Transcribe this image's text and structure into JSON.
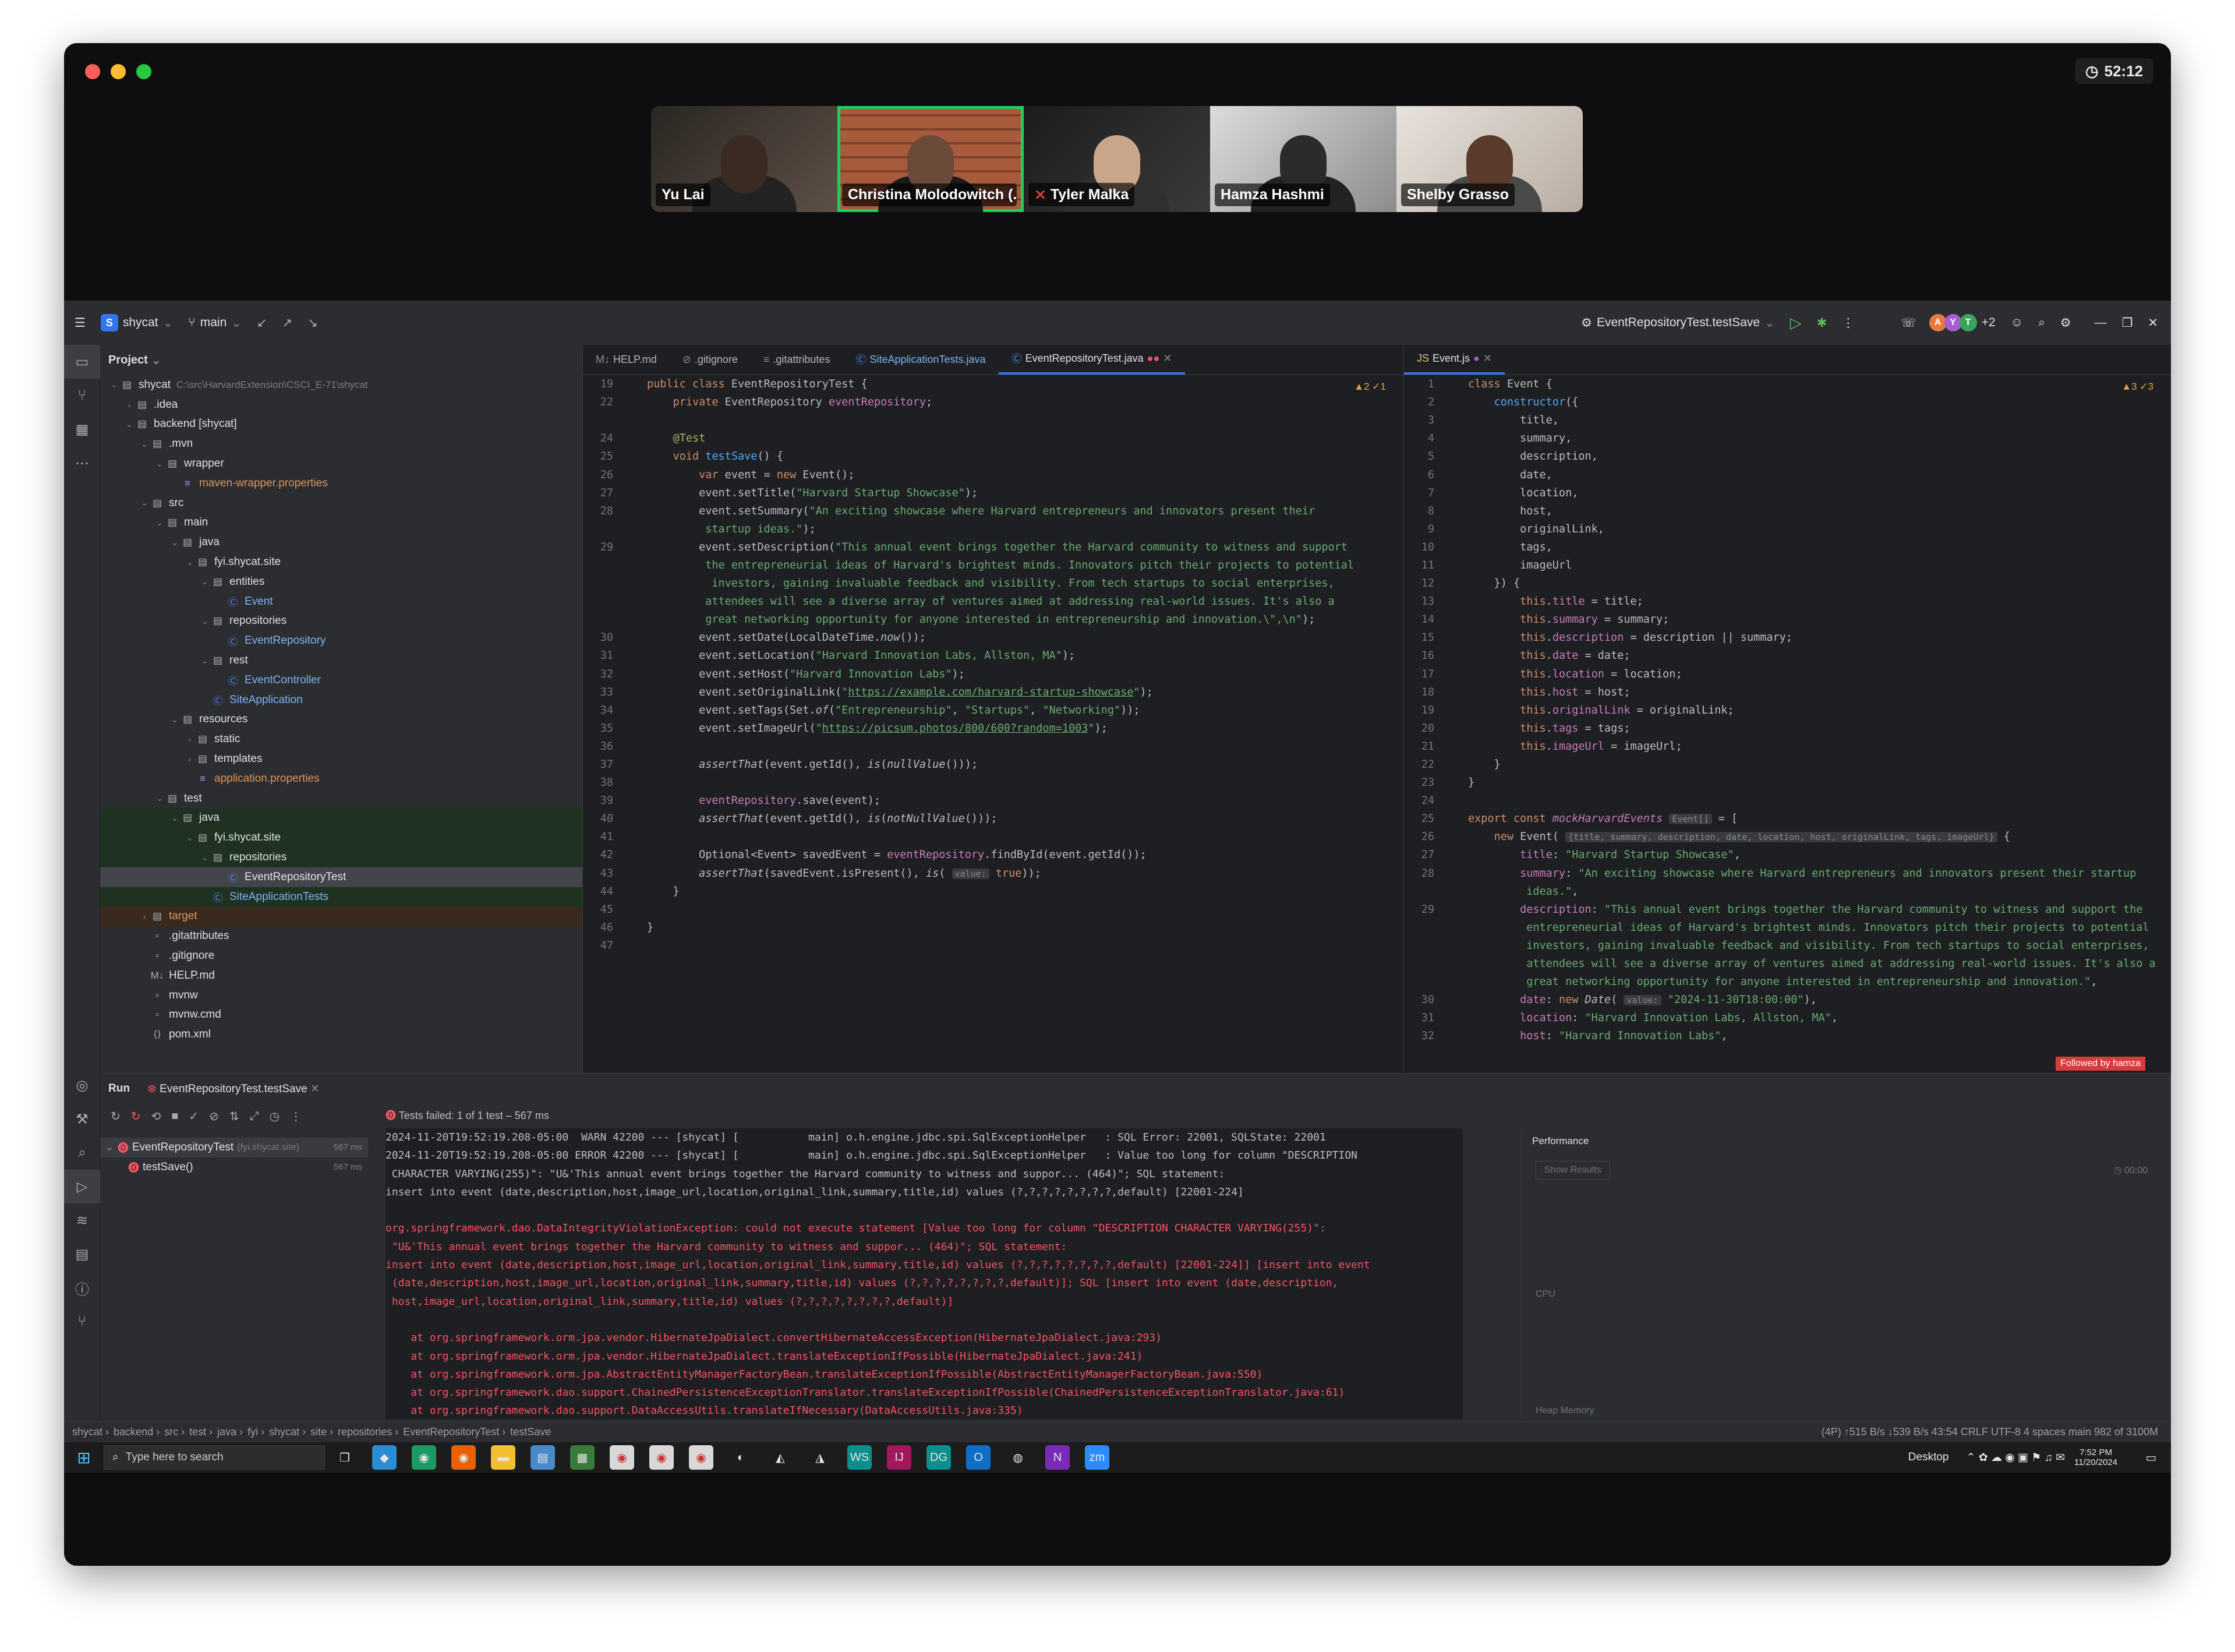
{
  "meeting": {
    "timer": "52:12",
    "participants": [
      "Yu Lai",
      "Christina Molodowitch (...",
      "Tyler Malka",
      "Hamza Hashmi",
      "Shelby Grasso"
    ]
  },
  "ide": {
    "project": "shycat",
    "branch": "main",
    "run_config": "EventRepositoryTest.testSave",
    "extra_users": "+2",
    "avatars": [
      "A",
      "Y",
      "T"
    ],
    "project_label": "Project",
    "tree": [
      {
        "label": "shycat",
        "hint": "C:\\src\\HarvardExtension\\CSCI_E-71\\shycat",
        "indent": 0,
        "icon": "folder",
        "open": true
      },
      {
        "label": ".idea",
        "indent": 1,
        "icon": "folder",
        "open": false
      },
      {
        "label": "backend [shycat]",
        "indent": 1,
        "icon": "folder",
        "open": true
      },
      {
        "label": ".mvn",
        "indent": 2,
        "icon": "folder",
        "open": true
      },
      {
        "label": "wrapper",
        "indent": 3,
        "icon": "folder",
        "open": true
      },
      {
        "label": "maven-wrapper.properties",
        "indent": 4,
        "icon": "props",
        "cls": "tgtf"
      },
      {
        "label": "src",
        "indent": 2,
        "icon": "folder",
        "open": true
      },
      {
        "label": "main",
        "indent": 3,
        "icon": "folder",
        "open": true
      },
      {
        "label": "java",
        "indent": 4,
        "icon": "folder",
        "open": true
      },
      {
        "label": "fyi.shycat.site",
        "indent": 5,
        "icon": "folder",
        "open": true
      },
      {
        "label": "entities",
        "indent": 6,
        "icon": "folder",
        "open": true
      },
      {
        "label": "Event",
        "indent": 7,
        "icon": "class"
      },
      {
        "label": "repositories",
        "indent": 6,
        "icon": "folder",
        "open": true
      },
      {
        "label": "EventRepository",
        "indent": 7,
        "icon": "class"
      },
      {
        "label": "rest",
        "indent": 6,
        "icon": "folder",
        "open": true
      },
      {
        "label": "EventController",
        "indent": 7,
        "icon": "class"
      },
      {
        "label": "SiteApplication",
        "indent": 6,
        "icon": "class"
      },
      {
        "label": "resources",
        "indent": 4,
        "icon": "folder",
        "open": true
      },
      {
        "label": "static",
        "indent": 5,
        "icon": "folder"
      },
      {
        "label": "templates",
        "indent": 5,
        "icon": "folder"
      },
      {
        "label": "application.properties",
        "indent": 5,
        "icon": "props",
        "cls": "tgtf"
      },
      {
        "label": "test",
        "indent": 3,
        "icon": "folder",
        "open": true
      },
      {
        "label": "java",
        "indent": 4,
        "icon": "folder",
        "open": true,
        "bg": "grn"
      },
      {
        "label": "fyi.shycat.site",
        "indent": 5,
        "icon": "folder",
        "open": true,
        "bg": "grn"
      },
      {
        "label": "repositories",
        "indent": 6,
        "icon": "folder",
        "open": true,
        "bg": "grn"
      },
      {
        "label": "EventRepositoryTest",
        "indent": 7,
        "icon": "class",
        "bg": "sel"
      },
      {
        "label": "SiteApplicationTests",
        "indent": 6,
        "icon": "class",
        "bg": "grn"
      },
      {
        "label": "target",
        "indent": 2,
        "icon": "folder",
        "open": false,
        "bg": "tgt",
        "cls": "tgtf"
      },
      {
        "label": ".gitattributes",
        "indent": 2,
        "icon": "file"
      },
      {
        "label": ".gitignore",
        "indent": 2,
        "icon": "file"
      },
      {
        "label": "HELP.md",
        "indent": 2,
        "icon": "md"
      },
      {
        "label": "mvnw",
        "indent": 2,
        "icon": "file"
      },
      {
        "label": "mvnw.cmd",
        "indent": 2,
        "icon": "file"
      },
      {
        "label": "pom.xml",
        "indent": 2,
        "icon": "xml"
      }
    ],
    "editor_tabs": [
      "HELP.md",
      ".gitignore",
      ".gitattributes",
      "SiteApplicationTests.java",
      "EventRepositoryTest.java"
    ],
    "right_tab": "Event.js",
    "inspections_left": "▲2 ✓1",
    "inspections_right": "▲3 ✓3",
    "left_code": [
      {
        "n": "19",
        "h": "<span class='kw'>public class</span> EventRepositoryTest {"
      },
      {
        "n": "22",
        "h": "    <span class='kw'>private</span> EventRepository <span class='fd'>eventRepository</span>;"
      },
      {
        "n": "",
        "h": ""
      },
      {
        "n": "24",
        "h": "    <span class='an'>@Test</span>"
      },
      {
        "n": "25",
        "h": "    <span class='kw'>void</span> <span class='fn'>testSave</span>() {"
      },
      {
        "n": "26",
        "h": "        <span class='kw'>var</span> event = <span class='kw'>new</span> Event();"
      },
      {
        "n": "27",
        "h": "        event.setTitle(<span class='st'>\"Harvard Startup Showcase\"</span>);"
      },
      {
        "n": "28",
        "h": "        event.setSummary(<span class='st'>\"An exciting showcase where Harvard entrepreneurs and innovators present their</span>"
      },
      {
        "n": "",
        "h": "<span class='st'>         startup ideas.\"</span>);"
      },
      {
        "n": "29",
        "h": "        event.setDescription(<span class='st'>\"This annual event brings together the Harvard community to witness and support</span>"
      },
      {
        "n": "",
        "h": "<span class='st'>         the entrepreneurial ideas of Harvard's brightest minds. Innovators pitch their projects to potential</span>"
      },
      {
        "n": "",
        "h": "<span class='st'>          investors, gaining invaluable feedback and visibility. From tech startups to social enterprises,</span>"
      },
      {
        "n": "",
        "h": "<span class='st'>         attendees will see a diverse array of ventures aimed at addressing real-world issues. It's also a</span>"
      },
      {
        "n": "",
        "h": "<span class='st'>         great networking opportunity for anyone interested in entrepreneurship and innovation.\\\",\\n\"</span>);"
      },
      {
        "n": "30",
        "h": "        event.setDate(LocalDateTime.<span class='it'>now</span>());"
      },
      {
        "n": "31",
        "h": "        event.setLocation(<span class='st'>\"Harvard Innovation Labs, Allston, MA\"</span>);"
      },
      {
        "n": "32",
        "h": "        event.setHost(<span class='st'>\"Harvard Innovation Labs\"</span>);"
      },
      {
        "n": "33",
        "h": "        event.setOriginalLink(<span class='st'>\"<span class='url'>https://example.com/harvard-startup-showcase</span>\"</span>);"
      },
      {
        "n": "34",
        "h": "        event.setTags(Set.<span class='it'>of</span>(<span class='st'>\"Entrepreneurship\"</span>, <span class='st'>\"Startups\"</span>, <span class='st'>\"Networking\"</span>));"
      },
      {
        "n": "35",
        "h": "        event.setImageUrl(<span class='st'>\"<span class='url'>https://picsum.photos/800/600?random=1003</span>\"</span>);"
      },
      {
        "n": "36",
        "h": ""
      },
      {
        "n": "37",
        "h": "        <span class='it'>assertThat</span>(event.getId(), <span class='it'>is</span>(<span class='it'>nullValue</span>()));"
      },
      {
        "n": "38",
        "h": ""
      },
      {
        "n": "39",
        "h": "        <span class='fd'>eventRepository</span>.save(event);"
      },
      {
        "n": "40",
        "h": "        <span class='it'>assertThat</span>(event.getId(), <span class='it'>is</span>(<span class='it'>notNullValue</span>()));"
      },
      {
        "n": "41",
        "h": ""
      },
      {
        "n": "42",
        "h": "        Optional&lt;Event&gt; savedEvent = <span class='fd'>eventRepository</span>.findById(event.getId());"
      },
      {
        "n": "43",
        "h": "        <span class='it'>assertThat</span>(savedEvent.isPresent(), <span class='it'>is</span>( <span class='hint'>value:</span> <span class='kw'>true</span>));"
      },
      {
        "n": "44",
        "h": "    }"
      },
      {
        "n": "45",
        "h": ""
      },
      {
        "n": "46",
        "h": "}"
      },
      {
        "n": "47",
        "h": ""
      }
    ],
    "right_code": [
      {
        "n": "1",
        "h": "<span class='kw'>class</span> Event {"
      },
      {
        "n": "2",
        "h": "    <span class='fn'>constructor</span>({"
      },
      {
        "n": "3",
        "h": "        title,"
      },
      {
        "n": "4",
        "h": "        summary,"
      },
      {
        "n": "5",
        "h": "        description,"
      },
      {
        "n": "6",
        "h": "        date,"
      },
      {
        "n": "7",
        "h": "        location,"
      },
      {
        "n": "8",
        "h": "        host,"
      },
      {
        "n": "9",
        "h": "        originalLink,"
      },
      {
        "n": "10",
        "h": "        tags,"
      },
      {
        "n": "11",
        "h": "        imageUrl"
      },
      {
        "n": "12",
        "h": "    }) {"
      },
      {
        "n": "13",
        "h": "        <span class='kw'>this</span>.<span class='fd'>title</span> = title;"
      },
      {
        "n": "14",
        "h": "        <span class='kw'>this</span>.<span class='fd'>summary</span> = summary;"
      },
      {
        "n": "15",
        "h": "        <span class='kw'>this</span>.<span class='fd'>description</span> = description || summary;"
      },
      {
        "n": "16",
        "h": "        <span class='kw'>this</span>.<span class='fd'>date</span> = date;"
      },
      {
        "n": "17",
        "h": "        <span class='kw'>this</span>.<span class='fd'>location</span> = location;"
      },
      {
        "n": "18",
        "h": "        <span class='kw'>this</span>.<span class='fd'>host</span> = host;"
      },
      {
        "n": "19",
        "h": "        <span class='kw'>this</span>.<span class='fd'>originalLink</span> = originalLink;"
      },
      {
        "n": "20",
        "h": "        <span class='kw'>this</span>.<span class='fd'>tags</span> = tags;"
      },
      {
        "n": "21",
        "h": "        <span class='kw'>this</span>.<span class='fd'>imageUrl</span> = imageUrl;"
      },
      {
        "n": "22",
        "h": "    }"
      },
      {
        "n": "23",
        "h": "}"
      },
      {
        "n": "24",
        "h": ""
      },
      {
        "n": "25",
        "h": "<span class='kw'>export const</span> <span class='fd it'>mockHarvardEvents</span> <span class='hint'>Event[]</span> = ["
      },
      {
        "n": "26",
        "h": "    <span class='kw'>new</span> Event( <span class='hint'>{title, summary, description, date, location, host, originalLink, tags, imageUrl}</span> {"
      },
      {
        "n": "27",
        "h": "        <span class='fd'>title</span>: <span class='st'>\"Harvard Startup Showcase\"</span>,"
      },
      {
        "n": "28",
        "h": "        <span class='fd'>summary</span>: <span class='st'>\"An exciting showcase where Harvard entrepreneurs and innovators present their startup</span>"
      },
      {
        "n": "",
        "h": "<span class='st'>         ideas.\"</span>,"
      },
      {
        "n": "29",
        "h": "        <span class='fd'>description</span>: <span class='st'>\"This annual event brings together the Harvard community to witness and support the</span>"
      },
      {
        "n": "",
        "h": "<span class='st'>         entrepreneurial ideas of Harvard's brightest minds. Innovators pitch their projects to potential</span>"
      },
      {
        "n": "",
        "h": "<span class='st'>         investors, gaining invaluable feedback and visibility. From tech startups to social enterprises,</span>"
      },
      {
        "n": "",
        "h": "<span class='st'>         attendees will see a diverse array of ventures aimed at addressing real-world issues. It's also a</span>"
      },
      {
        "n": "",
        "h": "<span class='st'>         great networking opportunity for anyone interested in entrepreneurship and innovation.\"</span>,"
      },
      {
        "n": "30",
        "h": "        <span class='fd'>date</span>: <span class='kw'>new</span> <span class='it'>Date</span>( <span class='hint'>value:</span> <span class='st'>\"2024-11-30T18:00:00\"</span>),"
      },
      {
        "n": "31",
        "h": "        <span class='fd'>location</span>: <span class='st'>\"Harvard Innovation Labs, Allston, MA\"</span>,"
      },
      {
        "n": "32",
        "h": "        <span class='fd'>host</span>: <span class='st'>\"Harvard Innovation Labs\"</span>,"
      }
    ],
    "followed": "Followed by hamza",
    "run": {
      "tab_run": "Run",
      "tab_cfg": "EventRepositoryTest.testSave",
      "failed": "Tests failed: 1 of 1 test – 567 ms",
      "tree": [
        {
          "label": "EventRepositoryTest",
          "hint": "(fyi.shycat.site)",
          "time": "567 ms"
        },
        {
          "label": "testSave()",
          "time": "567 ms"
        }
      ],
      "perf_title": "Performance",
      "show_results": "Show Results",
      "elapsed": "00:00",
      "cpu": "CPU",
      "heap": "Heap Memory"
    },
    "console": [
      {
        "c": "",
        "t": "2024-11-20T19:52:19.208-05:00  WARN 42200 --- [shycat] [           main] o.h.engine.jdbc.spi.SqlExceptionHelper   : SQL Error: 22001, SQLState: 22001"
      },
      {
        "c": "",
        "t": "2024-11-20T19:52:19.208-05:00 ERROR 42200 --- [shycat] [           main] o.h.engine.jdbc.spi.SqlExceptionHelper   : Value too long for column \"DESCRIPTION"
      },
      {
        "c": "",
        "t": " CHARACTER VARYING(255)\": \"U&'This annual event brings together the Harvard community to witness and suppor... (464)\"; SQL statement:"
      },
      {
        "c": "",
        "t": "insert into event (date,description,host,image_url,location,original_link,summary,title,id) values (?,?,?,?,?,?,?,?,default) [22001-224]"
      },
      {
        "c": "",
        "t": ""
      },
      {
        "c": "err",
        "t": "org.springframework.dao.DataIntegrityViolationException: could not execute statement [Value too long for column \"DESCRIPTION CHARACTER VARYING(255)\":"
      },
      {
        "c": "err",
        "t": " \"U&'This annual event brings together the Harvard community to witness and suppor... (464)\"; SQL statement:"
      },
      {
        "c": "err",
        "t": "insert into event (date,description,host,image_url,location,original_link,summary,title,id) values (?,?,?,?,?,?,?,?,default) [22001-224]] [insert into event"
      },
      {
        "c": "err",
        "t": " (date,description,host,image_url,location,original_link,summary,title,id) values (?,?,?,?,?,?,?,?,default)]; SQL [insert into event (date,description,"
      },
      {
        "c": "err",
        "t": " host,image_url,location,original_link,summary,title,id) values (?,?,?,?,?,?,?,?,default)]"
      },
      {
        "c": "",
        "t": ""
      },
      {
        "c": "err",
        "t": "    at org.springframework.orm.jpa.vendor.HibernateJpaDialect.convertHibernateAccessException(HibernateJpaDialect.java:293)"
      },
      {
        "c": "err",
        "t": "    at org.springframework.orm.jpa.vendor.HibernateJpaDialect.translateExceptionIfPossible(HibernateJpaDialect.java:241)"
      },
      {
        "c": "err",
        "t": "    at org.springframework.orm.jpa.AbstractEntityManagerFactoryBean.translateExceptionIfPossible(AbstractEntityManagerFactoryBean.java:550)"
      },
      {
        "c": "err",
        "t": "    at org.springframework.dao.support.ChainedPersistenceExceptionTranslator.translateExceptionIfPossible(ChainedPersistenceExceptionTranslator.java:61)"
      },
      {
        "c": "err",
        "t": "    at org.springframework.dao.support.DataAccessUtils.translateIfNecessary(DataAccessUtils.java:335)"
      }
    ],
    "breadcrumb": [
      "shycat",
      "backend",
      "src",
      "test",
      "java",
      "fyi",
      "shycat",
      "site",
      "repositories",
      "EventRepositoryTest",
      "testSave"
    ],
    "status_right": "(4P) ↑515 B/s ↓539 B/s   43:54   CRLF   UTF-8   4 spaces   main   982 of 3100M"
  },
  "taskbar": {
    "search": "Type here to search",
    "desktop": "Desktop",
    "time": "7:52 PM",
    "date": "11/20/2024"
  },
  "colors": {
    "accent": "#3574f0",
    "error": "#f75464",
    "active_speaker": "#1fcf5c"
  }
}
